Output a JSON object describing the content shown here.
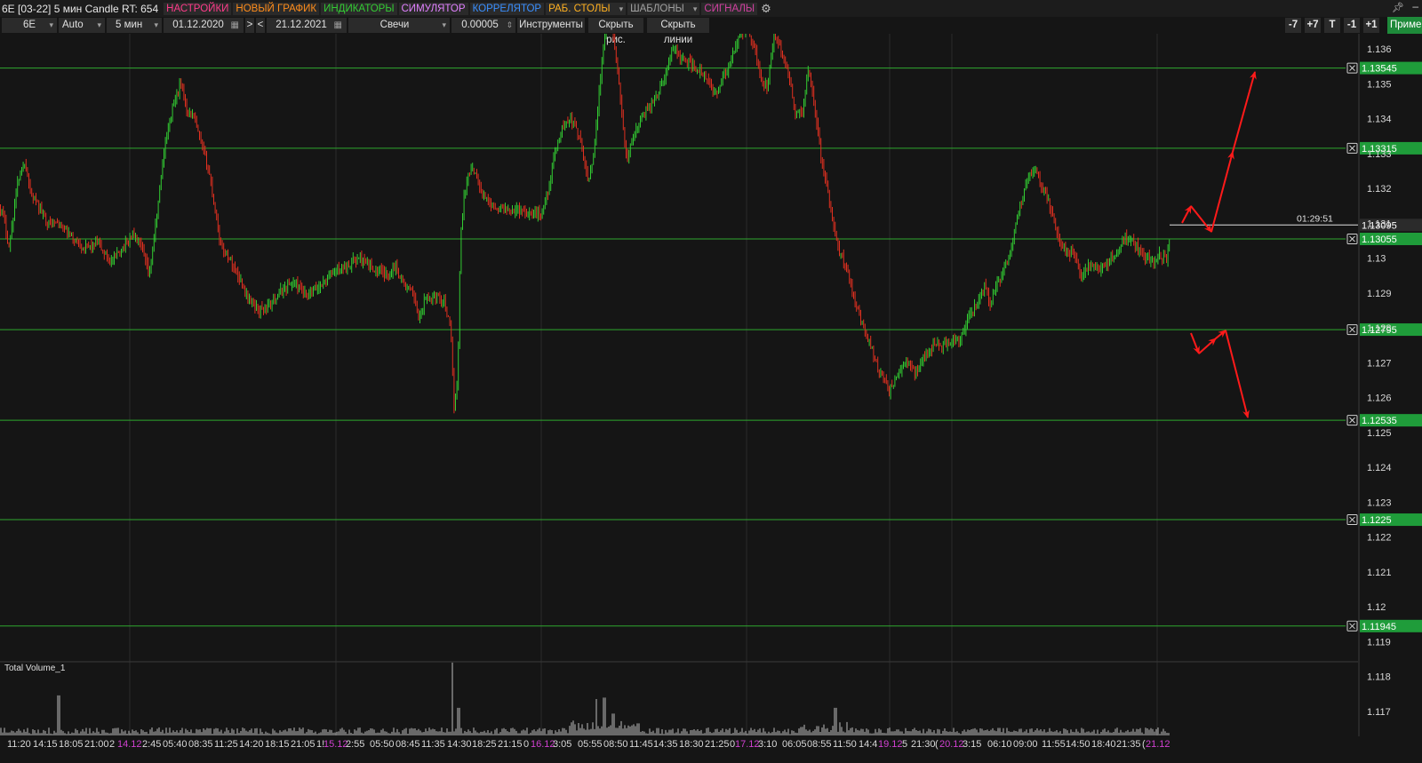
{
  "window_title": "6E [03-22] 5 мин Candle RT: 654",
  "menu": [
    {
      "label": "НАСТРОЙКИ",
      "color": "#ff3b8a",
      "dropdown": false
    },
    {
      "label": "НОВЫЙ ГРАФИК",
      "color": "#ff8c1a",
      "dropdown": false
    },
    {
      "label": "ИНДИКАТОРЫ",
      "color": "#33cc33",
      "dropdown": false
    },
    {
      "label": "СИМУЛЯТОР",
      "color": "#e080ff",
      "dropdown": false
    },
    {
      "label": "КОРРЕЛЯТОР",
      "color": "#3a8fff",
      "dropdown": false
    },
    {
      "label": "РАБ. СТОЛЫ",
      "color": "#ffb020",
      "dropdown": true
    },
    {
      "label": "ШАБЛОНЫ",
      "color": "#a0a0a0",
      "dropdown": true
    },
    {
      "label": "СИГНАЛЫ",
      "color": "#d040a0",
      "dropdown": false
    }
  ],
  "icons": {
    "settings": "gear-icon",
    "pin": "pin-icon",
    "minimize": "minimize-icon"
  },
  "toolbar": {
    "symbol": "6E",
    "scale": "Auto",
    "timeframe": "5 мин",
    "date_from": "01.12.2020",
    "next": ">",
    "prev": "<",
    "date_to": "21.12.2021",
    "chart_type": "Свечи",
    "step": "0.00005",
    "tools": "Инструменты",
    "hide_drawings": "Скрыть рис.",
    "hide_lines": "Скрыть линии",
    "nav": [
      "-7",
      "+7",
      "T",
      "-1",
      "+1"
    ],
    "apply": "Применить"
  },
  "colors": {
    "background": "#151515",
    "grid": "#2a2a2a",
    "level_line": "#2fa82f",
    "level_label_bg": "#1f9c3a",
    "bull": "#33cc33",
    "bear": "#e03020",
    "arrow": "#ff1a1a",
    "volume": "#bdbdbd"
  },
  "price_axis": {
    "ticks": [
      "1.136",
      "1.135",
      "1.134",
      "1.133",
      "1.132",
      "1.131",
      "1.13",
      "1.129",
      "1.128",
      "1.127",
      "1.126",
      "1.125",
      "1.124",
      "1.123",
      "1.122",
      "1.121",
      "1.12",
      "1.119",
      "1.118",
      "1.117"
    ],
    "current_price": "1.13095",
    "countdown": "01:29:51"
  },
  "levels": [
    "1.13545",
    "1.13315",
    "1.13055",
    "1.12795",
    "1.12535",
    "1.1225",
    "1.11945"
  ],
  "volume_panel": {
    "label": "Total Volume_1"
  },
  "time_axis": {
    "labels": [
      "11:20",
      "14:15",
      "18:05",
      "21:00",
      "2",
      "14.12",
      "2:45",
      "05:40",
      "08:35",
      "11:25",
      "14:20",
      "18:15",
      "21:05",
      "1!",
      "15.12",
      "2:55",
      "05:50",
      "08:45",
      "11:35",
      "14:30",
      "18:25",
      "21:15",
      "0",
      "16.12",
      "3:05",
      "05:55",
      "08:50",
      "11:45",
      "14:35",
      "18:30",
      "21:25",
      "0",
      "17.12",
      "3:10",
      "06:05",
      "08:55",
      "11:50",
      "14:4",
      "19.12",
      "5",
      "21:30",
      "(",
      "20.12",
      "3:15",
      "06:10",
      "09:00",
      "11:55",
      "14:50",
      "18:40",
      "21:35",
      "(",
      "21.12"
    ],
    "date_color": "#d040d0"
  },
  "chart_data": {
    "type": "candlestick",
    "symbol": "6E [03-22]",
    "interval": "5 мин",
    "ylim": [
      1.1165,
      1.1368
    ],
    "price_path": [
      [
        0,
        1.1315
      ],
      [
        5,
        1.1311
      ],
      [
        10,
        1.1303
      ],
      [
        20,
        1.1322
      ],
      [
        28,
        1.1328
      ],
      [
        35,
        1.1318
      ],
      [
        45,
        1.1314
      ],
      [
        55,
        1.131
      ],
      [
        65,
        1.131
      ],
      [
        80,
        1.1306
      ],
      [
        95,
        1.1303
      ],
      [
        110,
        1.1304
      ],
      [
        125,
        1.1299
      ],
      [
        135,
        1.1302
      ],
      [
        150,
        1.1307
      ],
      [
        160,
        1.1302
      ],
      [
        168,
        1.1295
      ],
      [
        175,
        1.1309
      ],
      [
        185,
        1.1332
      ],
      [
        195,
        1.1344
      ],
      [
        203,
        1.135
      ],
      [
        210,
        1.1343
      ],
      [
        218,
        1.134
      ],
      [
        225,
        1.1334
      ],
      [
        235,
        1.1325
      ],
      [
        242,
        1.1314
      ],
      [
        248,
        1.1304
      ],
      [
        260,
        1.1299
      ],
      [
        270,
        1.1294
      ],
      [
        280,
        1.1288
      ],
      [
        292,
        1.1285
      ],
      [
        305,
        1.1287
      ],
      [
        318,
        1.1291
      ],
      [
        330,
        1.1293
      ],
      [
        345,
        1.1289
      ],
      [
        360,
        1.1292
      ],
      [
        375,
        1.1296
      ],
      [
        390,
        1.1298
      ],
      [
        405,
        1.13
      ],
      [
        420,
        1.1297
      ],
      [
        435,
        1.1295
      ],
      [
        445,
        1.1298
      ],
      [
        455,
        1.1292
      ],
      [
        465,
        1.129
      ],
      [
        472,
        1.1282
      ],
      [
        478,
        1.1288
      ],
      [
        490,
        1.1289
      ],
      [
        500,
        1.1288
      ],
      [
        507,
        1.1279
      ],
      [
        511,
        1.1257
      ],
      [
        515,
        1.1266
      ],
      [
        518,
        1.1305
      ],
      [
        522,
        1.1318
      ],
      [
        528,
        1.1325
      ],
      [
        535,
        1.1325
      ],
      [
        541,
        1.1319
      ],
      [
        547,
        1.1317
      ],
      [
        555,
        1.1315
      ],
      [
        565,
        1.1314
      ],
      [
        580,
        1.1314
      ],
      [
        595,
        1.1313
      ],
      [
        610,
        1.1313
      ],
      [
        618,
        1.1321
      ],
      [
        625,
        1.1331
      ],
      [
        632,
        1.1337
      ],
      [
        640,
        1.134
      ],
      [
        648,
        1.1338
      ],
      [
        655,
        1.1331
      ],
      [
        662,
        1.1322
      ],
      [
        668,
        1.133
      ],
      [
        675,
        1.135
      ],
      [
        682,
        1.1368
      ],
      [
        690,
        1.1365
      ],
      [
        698,
        1.1345
      ],
      [
        705,
        1.1328
      ],
      [
        712,
        1.1334
      ],
      [
        720,
        1.1339
      ],
      [
        728,
        1.1343
      ],
      [
        738,
        1.1346
      ],
      [
        748,
        1.1352
      ],
      [
        758,
        1.1361
      ],
      [
        765,
        1.1357
      ],
      [
        775,
        1.1356
      ],
      [
        785,
        1.1354
      ],
      [
        795,
        1.1351
      ],
      [
        805,
        1.1347
      ],
      [
        815,
        1.1352
      ],
      [
        825,
        1.1358
      ],
      [
        832,
        1.1364
      ],
      [
        840,
        1.1366
      ],
      [
        848,
        1.1362
      ],
      [
        855,
        1.1352
      ],
      [
        863,
        1.1349
      ],
      [
        872,
        1.1364
      ],
      [
        880,
        1.1359
      ],
      [
        888,
        1.1351
      ],
      [
        895,
        1.1341
      ],
      [
        903,
        1.1342
      ],
      [
        910,
        1.1355
      ],
      [
        917,
        1.1343
      ],
      [
        924,
        1.1328
      ],
      [
        930,
        1.1321
      ],
      [
        937,
        1.131
      ],
      [
        944,
        1.1302
      ],
      [
        952,
        1.1298
      ],
      [
        960,
        1.129
      ],
      [
        970,
        1.1281
      ],
      [
        980,
        1.1275
      ],
      [
        990,
        1.1267
      ],
      [
        1000,
        1.1262
      ],
      [
        1010,
        1.1266
      ],
      [
        1020,
        1.1271
      ],
      [
        1030,
        1.1267
      ],
      [
        1040,
        1.1272
      ],
      [
        1050,
        1.1275
      ],
      [
        1060,
        1.1275
      ],
      [
        1070,
        1.1276
      ],
      [
        1080,
        1.1276
      ],
      [
        1090,
        1.1283
      ],
      [
        1100,
        1.1287
      ],
      [
        1108,
        1.1293
      ],
      [
        1114,
        1.1287
      ],
      [
        1120,
        1.1291
      ],
      [
        1128,
        1.1296
      ],
      [
        1136,
        1.1301
      ],
      [
        1143,
        1.1309
      ],
      [
        1150,
        1.1317
      ],
      [
        1157,
        1.1324
      ],
      [
        1164,
        1.1326
      ],
      [
        1170,
        1.1322
      ],
      [
        1177,
        1.1318
      ],
      [
        1184,
        1.1313
      ],
      [
        1192,
        1.1304
      ],
      [
        1200,
        1.1302
      ],
      [
        1208,
        1.1301
      ],
      [
        1216,
        1.1295
      ],
      [
        1226,
        1.1298
      ],
      [
        1236,
        1.1297
      ],
      [
        1246,
        1.1298
      ],
      [
        1256,
        1.1302
      ],
      [
        1266,
        1.1306
      ],
      [
        1276,
        1.1304
      ],
      [
        1286,
        1.1301
      ],
      [
        1296,
        1.1299
      ],
      [
        1306,
        1.1301
      ],
      [
        1312,
        1.1299
      ],
      [
        1316,
        1.1305
      ]
    ],
    "volume_spikes": [
      [
        66,
        0.55
      ],
      [
        509,
        1.0
      ],
      [
        516,
        0.38
      ],
      [
        671,
        0.5
      ],
      [
        680,
        0.52
      ],
      [
        690,
        0.3
      ],
      [
        940,
        0.38
      ]
    ]
  }
}
